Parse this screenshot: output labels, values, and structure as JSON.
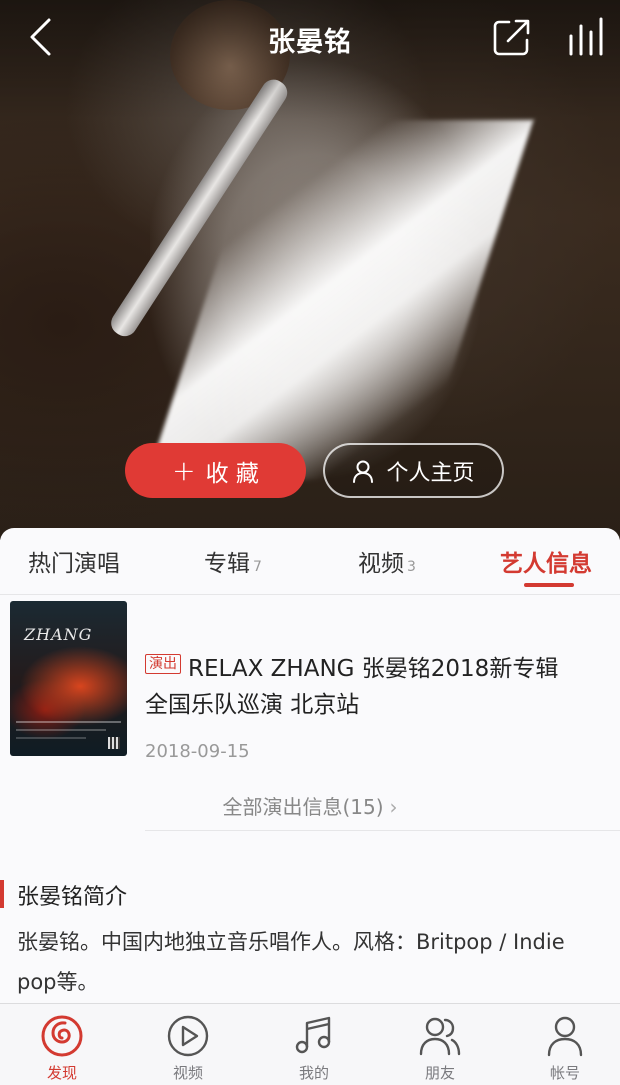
{
  "nav": {
    "title": "张晏铭",
    "back_icon": "chevron-left-icon",
    "share_icon": "share-icon",
    "equalizer_icon": "equalizer-icon"
  },
  "hero": {
    "collect_label": "收 藏",
    "homepage_label": "个人主页"
  },
  "tabs": [
    {
      "label": "热门演唱",
      "count": ""
    },
    {
      "label": "专辑",
      "count": "7"
    },
    {
      "label": "视频",
      "count": "3"
    },
    {
      "label": "艺人信息",
      "count": ""
    }
  ],
  "active_tab": "艺人信息",
  "event": {
    "badge": "演出",
    "title_line1": "RELAX ZHANG 张晏铭2018新专辑",
    "title_line2": "全国乐队巡演 北京站",
    "date": "2018-09-15",
    "poster_text": "ZHANG"
  },
  "all_events": {
    "label": "全部演出信息(15)",
    "chevron": "›"
  },
  "intro": {
    "title": "张晏铭简介",
    "body": "张晏铭。中国内地独立音乐唱作人。风格：Britpop / Indie pop等。"
  },
  "tabbar": [
    {
      "label": "发现",
      "icon": "netease-logo-icon",
      "active": true
    },
    {
      "label": "视频",
      "icon": "video-play-icon",
      "active": false
    },
    {
      "label": "我的",
      "icon": "music-note-icon",
      "active": false
    },
    {
      "label": "朋友",
      "icon": "friends-icon",
      "active": false
    },
    {
      "label": "帐号",
      "icon": "account-icon",
      "active": false
    }
  ],
  "colors": {
    "accent": "#d33a31",
    "collect_button": "#e03a35"
  }
}
